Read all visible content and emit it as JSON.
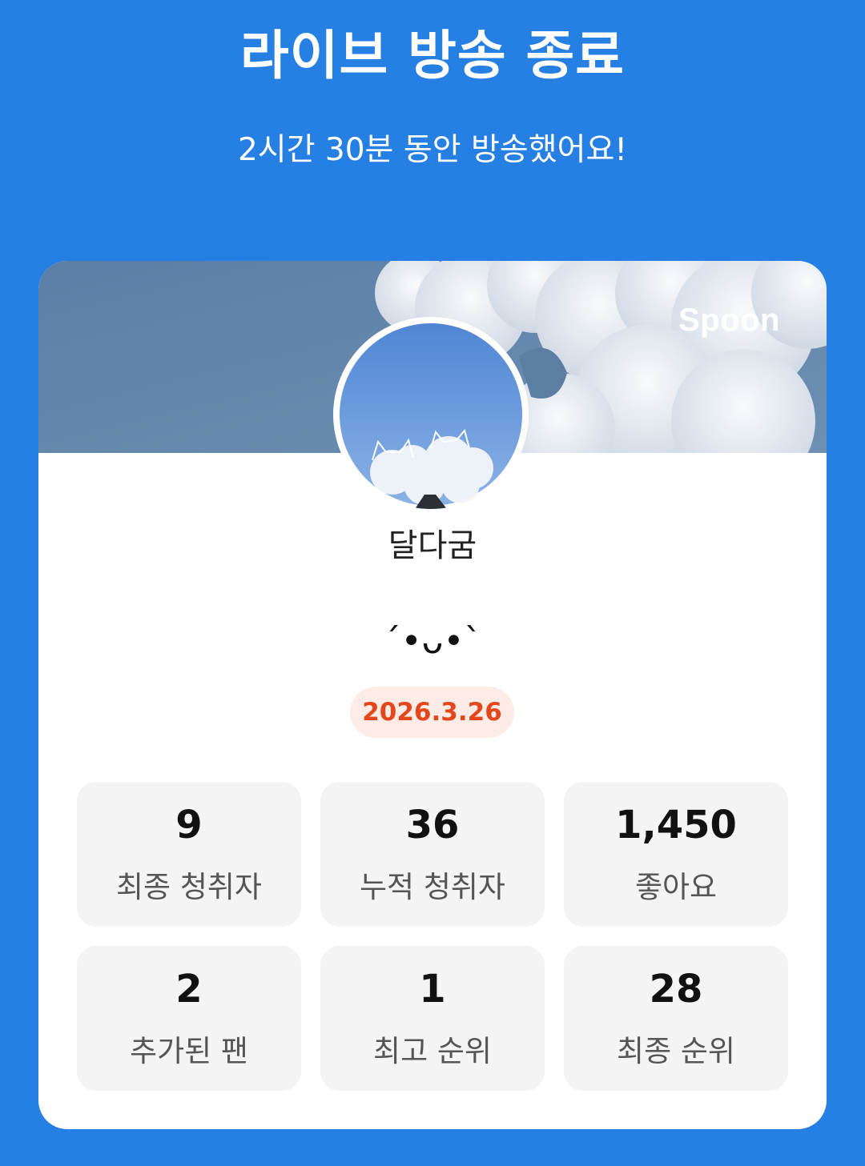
{
  "header": {
    "title": "라이브 방송 종료",
    "subtitle": "2시간 30분 동안 방송했어요!"
  },
  "card": {
    "brand": "Spoon",
    "username": "달다굼",
    "bio": "ˊ•ᴗ•ˋ",
    "date": "2026.3.26",
    "stats": [
      {
        "value": "9",
        "label": "최종 청취자"
      },
      {
        "value": "36",
        "label": "누적 청취자"
      },
      {
        "value": "1,450",
        "label": "좋아요"
      },
      {
        "value": "2",
        "label": "추가된 팬"
      },
      {
        "value": "1",
        "label": "최고 순위"
      },
      {
        "value": "28",
        "label": "최종 순위"
      }
    ]
  },
  "colors": {
    "background": "#2680e3",
    "card": "#ffffff",
    "stat_tile": "#f4f4f5",
    "date_badge_bg": "#fdebe6",
    "date_badge_text": "#e4471c"
  }
}
